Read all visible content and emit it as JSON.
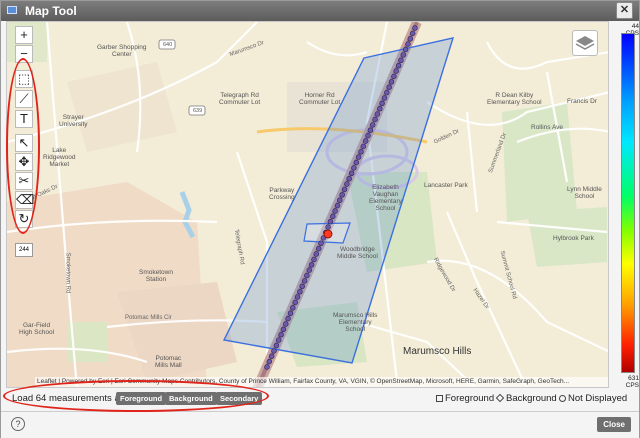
{
  "window": {
    "title": "Map Tool",
    "close_glyph": "✕"
  },
  "toolbar": {
    "zoom_in": "+",
    "zoom_out": "−",
    "tools": [
      {
        "name": "select-rect-tool",
        "glyph": "⬚"
      },
      {
        "name": "polyline-tool",
        "glyph": "⟋"
      },
      {
        "name": "text-tool",
        "glyph": "T"
      },
      {
        "name": "pointer-tool",
        "glyph": "↖"
      },
      {
        "name": "move-tool",
        "glyph": "✥"
      },
      {
        "name": "cut-tool",
        "glyph": "✂"
      },
      {
        "name": "eraser-tool",
        "glyph": "⌫"
      },
      {
        "name": "rotate-tool",
        "glyph": "↻"
      }
    ],
    "scale_label": "244"
  },
  "map": {
    "labels": [
      {
        "text": "Garber Shopping\nCenter"
      },
      {
        "text": "Strayer\nUniversity"
      },
      {
        "text": "Telegraph Rd\nCommuter Lot"
      },
      {
        "text": "Horner Rd\nCommuter Lot"
      },
      {
        "text": "Lake\nRidgewood\nMarket"
      },
      {
        "text": "Parkway\nCrossing"
      },
      {
        "text": "Elizabeth\nVaughan\nElementary\nSchool"
      },
      {
        "text": "Lancaster Park"
      },
      {
        "text": "Woodbridge\nMiddle School"
      },
      {
        "text": "Smoketown\nStation"
      },
      {
        "text": "Gar-Field\nHigh School"
      },
      {
        "text": "Potomac\nMills Mall"
      },
      {
        "text": "Marumsco Hills\nElementary\nSchool"
      },
      {
        "text": "R Dean Kilby\nElementary School"
      },
      {
        "text": "Lynn Middle\nSchool"
      },
      {
        "text": "Hylbrook Park"
      },
      {
        "text": "Rollins Ave"
      },
      {
        "text": "Francis Dr"
      },
      {
        "text": "Marumsco Hills"
      }
    ],
    "roads": [
      {
        "text": "Smoketown Rd"
      },
      {
        "text": "Telegraph Rd"
      },
      {
        "text": "Potomac Mills Cir"
      },
      {
        "text": "Summit School Rd"
      },
      {
        "text": "Hazel Dr"
      },
      {
        "text": "Ridgewood Dr"
      },
      {
        "text": "Gt Oaks Dr"
      },
      {
        "text": "Marumsco Dr"
      },
      {
        "text": "Summerland Dr"
      },
      {
        "text": "Golden Dr"
      }
    ],
    "shields": [
      "640",
      "639"
    ],
    "attribution": "Leaflet | Powered by Esri | Esri Community Maps Contributors, County of Prince William, Fairfax County, VA, VGIN, © OpenStreetMap, Microsoft, HERE, Garmin, SafeGraph, GeoTech..."
  },
  "colorbar": {
    "top_label": "44\nCPS",
    "bottom_label": "631\nCPS"
  },
  "load_bar": {
    "text": "Load 64 measurements as:",
    "buttons": [
      "Foreground",
      "Background",
      "Secondary"
    ],
    "legend": [
      "Foreground",
      "Background",
      "Not Displayed"
    ]
  },
  "footer": {
    "help": "?",
    "close": "Close"
  },
  "colors": {
    "accent_red": "#e0241b",
    "polygon": "#3b6fe0",
    "route": "#6b5aa8"
  }
}
